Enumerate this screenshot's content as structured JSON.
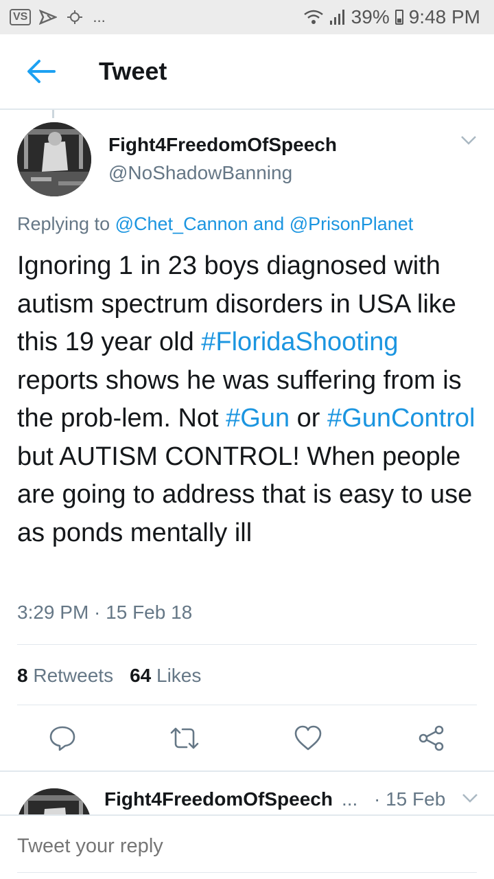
{
  "status_bar": {
    "left_label": "VS",
    "more": "...",
    "battery": "39%",
    "time": "9:48 PM"
  },
  "header": {
    "title": "Tweet"
  },
  "tweet": {
    "display_name": "Fight4FreedomOfSpeech",
    "handle": "@NoShadowBanning",
    "replying_prefix": "Replying to",
    "reply_to_1": "@Chet_Cannon",
    "reply_and": "and",
    "reply_to_2": "@PrisonPlanet",
    "text_parts": {
      "p1": "Ignoring 1 in 23 boys diagnosed with autism spectrum disorders in USA like this 19 year old ",
      "tag1": "#FloridaShooting",
      "p2": " reports shows he was suffering from is the prob-lem. Not ",
      "tag2": "#Gun",
      "p3": " or ",
      "tag3": "#GunControl",
      "p4": " but AUTISM CONTROL! When people are going to address that is easy to use as ponds mentally ill"
    },
    "timestamp": "3:29 PM · 15 Feb 18",
    "retweets_count": "8",
    "retweets_label": "Retweets",
    "likes_count": "64",
    "likes_label": "Likes"
  },
  "reply_preview": {
    "display_name": "Fight4FreedomOfSpeech",
    "ellipsis": "...",
    "date": "· 15 Feb"
  },
  "reply_bar": {
    "placeholder": "Tweet your reply"
  },
  "colors": {
    "accent": "#1b95e0",
    "text": "#14171a",
    "secondary": "#657786",
    "divider": "#e1e8ed"
  }
}
